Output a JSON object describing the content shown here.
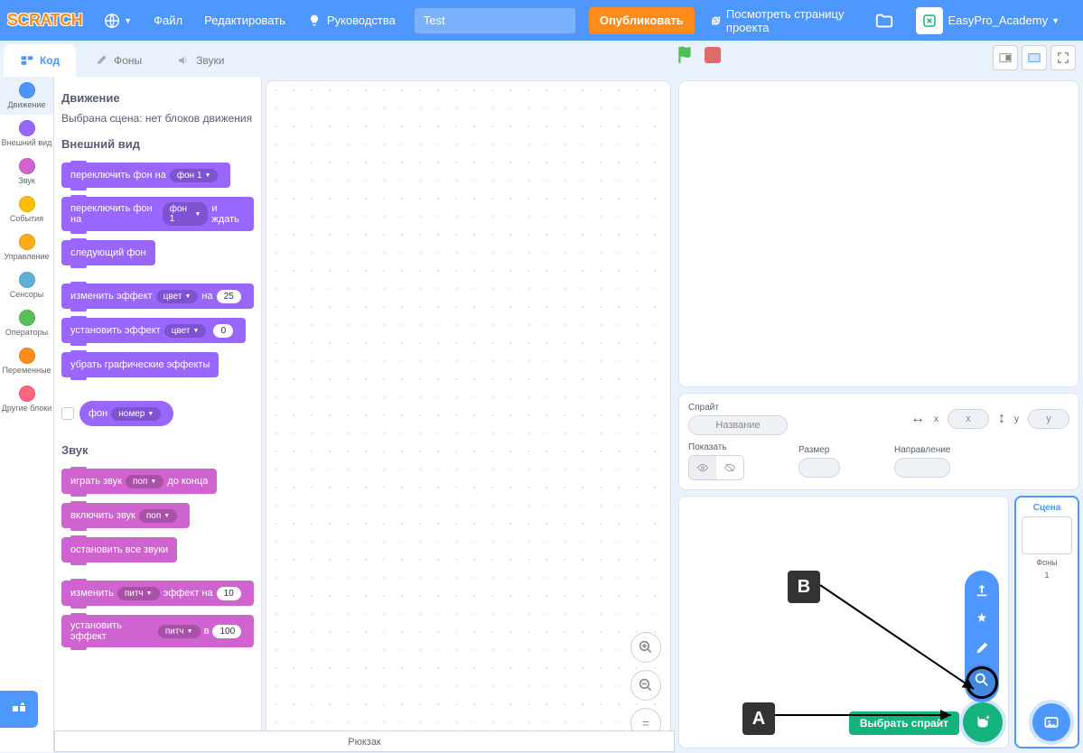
{
  "menubar": {
    "logo": "SCRATCH",
    "file": "Файл",
    "edit": "Редактировать",
    "tutorials": "Руководства",
    "project_title": "Test",
    "share": "Опубликовать",
    "see_project_page": "Посмотреть страницу проекта",
    "username": "EasyPro_Academy"
  },
  "tabs": {
    "code": "Код",
    "costumes": "Фоны",
    "sounds": "Звуки"
  },
  "categories": [
    {
      "name": "Движение",
      "color": "#4c97ff"
    },
    {
      "name": "Внешний вид",
      "color": "#9966ff"
    },
    {
      "name": "Звук",
      "color": "#cf63cf"
    },
    {
      "name": "События",
      "color": "#ffbf00"
    },
    {
      "name": "Управление",
      "color": "#ffab19"
    },
    {
      "name": "Сенсоры",
      "color": "#5cb1d6"
    },
    {
      "name": "Операторы",
      "color": "#59c059"
    },
    {
      "name": "Переменные",
      "color": "#ff8c1a"
    },
    {
      "name": "Другие блоки",
      "color": "#ff6680"
    }
  ],
  "palette": {
    "motion_heading": "Движение",
    "motion_empty": "Выбрана сцена: нет блоков движения",
    "looks_heading": "Внешний вид",
    "switch_backdrop": "переключить фон на",
    "backdrop1": "фон 1",
    "switch_backdrop_wait": "переключить фон на",
    "and_wait": "и ждать",
    "next_backdrop": "следующий фон",
    "change_effect": "изменить эффект",
    "color_opt": "цвет",
    "by": "на",
    "val25": "25",
    "set_effect": "установить эффект",
    "val0": "0",
    "clear_effects": "убрать графические эффекты",
    "backdrop_reporter_a": "фон",
    "backdrop_reporter_b": "номер",
    "sound_heading": "Звук",
    "play_until_done_a": "играть звук",
    "pop": "поп",
    "play_until_done_b": "до конца",
    "start_sound": "включить звук",
    "stop_all_sounds": "остановить все звуки",
    "change_pitch_a": "изменить",
    "pitch": "питч",
    "change_pitch_b": "эффект на",
    "val10": "10",
    "set_pitch_a": "установить эффект",
    "set_pitch_b": "в",
    "val100": "100"
  },
  "sprite_info": {
    "sprite_label": "Спрайт",
    "name_placeholder": "Название",
    "x_label": "x",
    "x_val": "x",
    "y_label": "y",
    "y_val": "y",
    "show_label": "Показать",
    "size_label": "Размер",
    "direction_label": "Направление"
  },
  "stage_panel": {
    "label": "Сцена",
    "backdrops_label": "Фоны",
    "backdrops_count": "1"
  },
  "sprite_add": {
    "tooltip": "Выбрать спрайт"
  },
  "annotations": {
    "A": "A",
    "B": "B"
  },
  "backpack": "Рюкзак"
}
